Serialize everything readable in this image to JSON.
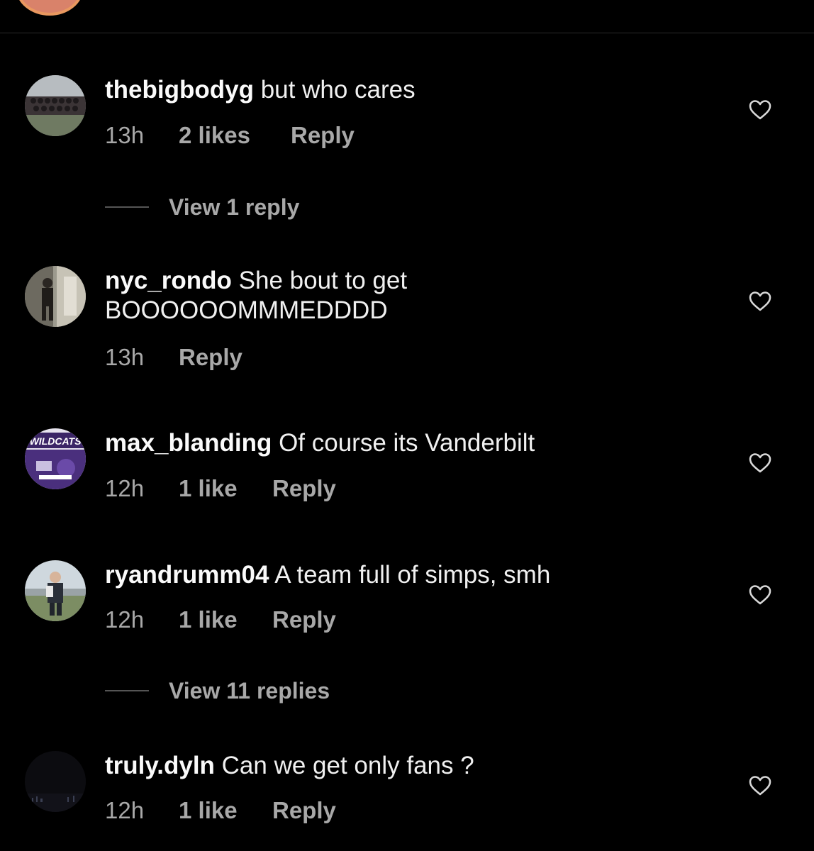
{
  "comments": [
    {
      "username": "thebigbodyg",
      "text": "but who cares",
      "time": "13h",
      "likes": "2 likes",
      "reply": "Reply",
      "view_replies": "View 1 reply"
    },
    {
      "username": "nyc_rondo",
      "text": "She bout to get BOOOOOOMMMEDDDD",
      "time": "13h",
      "likes": "",
      "reply": "Reply",
      "view_replies": ""
    },
    {
      "username": "max_blanding",
      "text": "Of course its Vanderbilt",
      "time": "12h",
      "likes": "1 like",
      "reply": "Reply",
      "view_replies": "",
      "avatar_text": "WILDCATS"
    },
    {
      "username": "ryandrumm04",
      "text": "A team full of simps, smh",
      "time": "12h",
      "likes": "1 like",
      "reply": "Reply",
      "view_replies": "View 11 replies"
    },
    {
      "username": "truly.dyln",
      "text": "Can we get only fans ?",
      "time": "12h",
      "likes": "1 like",
      "reply": "Reply",
      "view_replies": ""
    }
  ],
  "colors": {
    "background": "#000000",
    "primary_text": "#f0f0f0",
    "secondary_text": "#a8a8a8",
    "story_ring": "#e9985f"
  }
}
